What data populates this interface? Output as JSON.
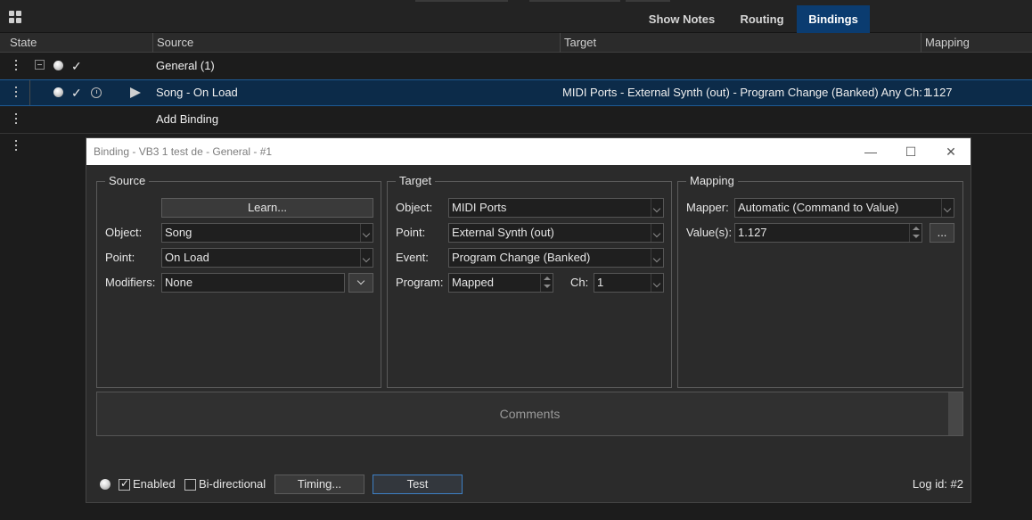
{
  "tabs": [
    {
      "label": "Show Notes"
    },
    {
      "label": "Routing"
    },
    {
      "label": "Bindings",
      "active": true
    }
  ],
  "columns": {
    "state": "State",
    "source": "Source",
    "target": "Target",
    "mapping": "Mapping"
  },
  "rows": {
    "group": {
      "source": "General (1)"
    },
    "binding": {
      "source": "Song - On Load",
      "target": "MIDI Ports - External Synth (out) - Program Change (Banked) Any Ch: 1",
      "mapping": "1.127"
    },
    "add": {
      "source": "Add Binding"
    }
  },
  "dialog": {
    "title": "Binding - VB3 1 test de - General - #1",
    "source": {
      "title": "Source",
      "learn_label": "Learn...",
      "object_label": "Object:",
      "object_value": "Song",
      "point_label": "Point:",
      "point_value": "On Load",
      "modifiers_label": "Modifiers:",
      "modifiers_value": "None"
    },
    "target": {
      "title": "Target",
      "object_label": "Object:",
      "object_value": "MIDI Ports",
      "point_label": "Point:",
      "point_value": "External Synth (out)",
      "event_label": "Event:",
      "event_value": "Program Change (Banked)",
      "program_label": "Program:",
      "program_value": "Mapped",
      "ch_label": "Ch:",
      "ch_value": "1"
    },
    "mapping": {
      "title": "Mapping",
      "mapper_label": "Mapper:",
      "mapper_value": "Automatic (Command to Value)",
      "values_label": "Value(s):",
      "values_value": "1.127",
      "more_label": "..."
    },
    "comments_placeholder": "Comments",
    "footer": {
      "enabled_label": "Enabled",
      "enabled_checked": true,
      "bidirectional_label": "Bi-directional",
      "bidirectional_checked": false,
      "timing_label": "Timing...",
      "test_label": "Test",
      "log_id": "Log id: #2"
    }
  },
  "colors": {
    "accent": "#0b3c70",
    "selected_row": "#0c2b49",
    "background": "#1c1c1c",
    "dialog": "#2b2b2b"
  }
}
